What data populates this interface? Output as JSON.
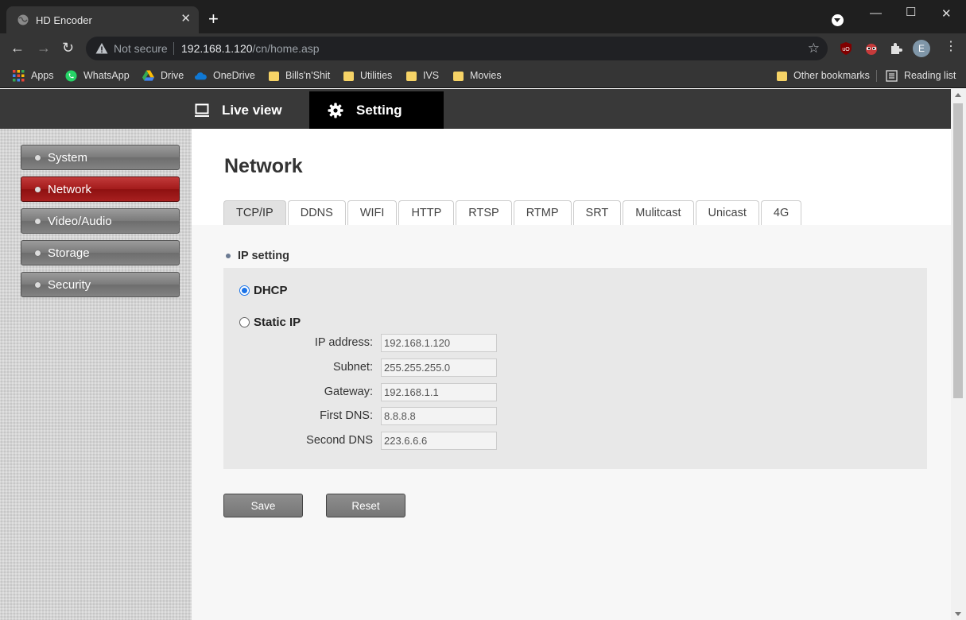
{
  "browser": {
    "tab_title": "HD Encoder",
    "not_secure": "Not secure",
    "url_host": "192.168.1.120",
    "url_path": "/cn/home.asp",
    "profile_initial": "E",
    "bookmarks": [
      "Apps",
      "WhatsApp",
      "Drive",
      "OneDrive",
      "Bills'n'Shit",
      "Utilities",
      "IVS",
      "Movies"
    ],
    "other_bookmarks": "Other bookmarks",
    "reading_list": "Reading list"
  },
  "topnav": {
    "live_view": "Live view",
    "setting": "Setting"
  },
  "sidebar": {
    "items": [
      {
        "label": "System",
        "active": false
      },
      {
        "label": "Network",
        "active": true
      },
      {
        "label": "Video/Audio",
        "active": false
      },
      {
        "label": "Storage",
        "active": false
      },
      {
        "label": "Security",
        "active": false
      }
    ]
  },
  "main": {
    "title": "Network",
    "tabs": [
      "TCP/IP",
      "DDNS",
      "WIFI",
      "HTTP",
      "RTSP",
      "RTMP",
      "SRT",
      "Mulitcast",
      "Unicast",
      "4G"
    ],
    "active_tab": "TCP/IP",
    "section_title": "IP setting",
    "dhcp_label": "DHCP",
    "static_label": "Static IP",
    "mode": "DHCP",
    "fields": [
      {
        "label": "IP address:",
        "value": "192.168.1.120"
      },
      {
        "label": "Subnet:",
        "value": "255.255.255.0"
      },
      {
        "label": "Gateway:",
        "value": "192.168.1.1"
      },
      {
        "label": "First DNS:",
        "value": "8.8.8.8"
      },
      {
        "label": "Second DNS",
        "value": "223.6.6.6"
      }
    ],
    "save_label": "Save",
    "reset_label": "Reset"
  },
  "colors": {
    "active_sidebar": "#a21b1b",
    "topnav_bg": "#393939",
    "radio_accent": "#1a73e8"
  }
}
